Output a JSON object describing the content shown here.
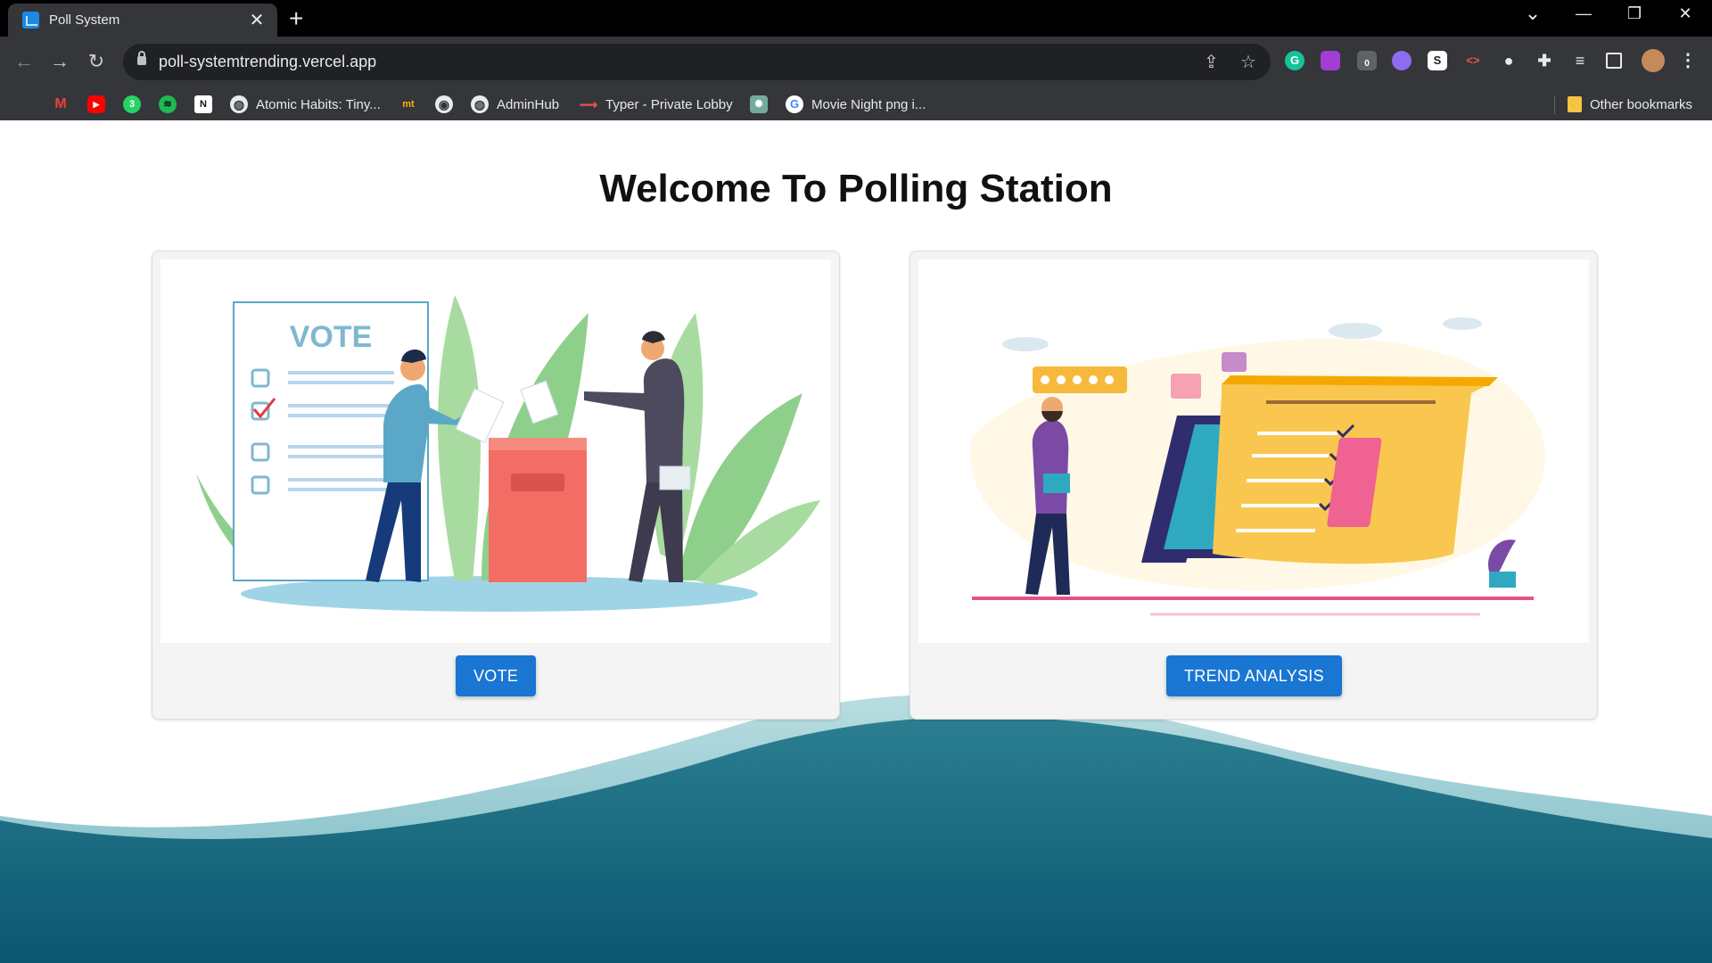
{
  "browser": {
    "tab_title": "Poll System",
    "tab_close": "✕",
    "new_tab": "+",
    "url": "poll-systemtrending.vercel.app",
    "window_controls": {
      "tabsearch": "⌄",
      "minimize": "—",
      "restore": "❐",
      "close": "✕"
    },
    "nav": {
      "back": "←",
      "forward": "→",
      "reload": "↻"
    },
    "omnibox_icons": {
      "share": "⇪",
      "bookmark": "☆"
    },
    "extensions": [
      "G",
      "S",
      "<>",
      "●",
      "0"
    ],
    "bookmarks": [
      {
        "label": "",
        "icon": "profile-icon",
        "color": "#4a6fa5"
      },
      {
        "label": "",
        "icon": "gmail-icon",
        "color": "#ea4335",
        "glyph": "M"
      },
      {
        "label": "",
        "icon": "youtube-icon",
        "color": "#ff0000",
        "glyph": "▶"
      },
      {
        "label": "",
        "icon": "whatsapp-icon",
        "color": "#25d366",
        "glyph": "3"
      },
      {
        "label": "",
        "icon": "spotify-icon",
        "color": "#1db954",
        "glyph": "≋"
      },
      {
        "label": "",
        "icon": "notion-icon",
        "color": "#ffffff",
        "glyph": "N"
      },
      {
        "label": "Atomic Habits: Tiny...",
        "icon": "globe-icon",
        "color": "#e8eaed",
        "glyph": "◍"
      },
      {
        "label": "",
        "icon": "mt-icon",
        "color": "#35363a",
        "glyph": "mt"
      },
      {
        "label": "",
        "icon": "github-icon",
        "color": "#e8eaed",
        "glyph": "◉"
      },
      {
        "label": "AdminHub",
        "icon": "globe-icon",
        "color": "#e8eaed",
        "glyph": "◍"
      },
      {
        "label": "Typer - Private Lobby",
        "icon": "typer-icon",
        "color": "#35363a",
        "glyph": "⟿"
      },
      {
        "label": "",
        "icon": "chatgpt-icon",
        "color": "#74aa9c",
        "glyph": "✺"
      },
      {
        "label": "Movie Night png i...",
        "icon": "google-icon",
        "color": "#ffffff",
        "glyph": "G"
      }
    ],
    "other_bookmarks": "Other bookmarks"
  },
  "page": {
    "heading": "Welcome To Polling Station",
    "cards": {
      "vote": {
        "button": "VOTE",
        "ballot_text": "VOTE"
      },
      "trend": {
        "button": "TREND ANALYSIS"
      }
    }
  },
  "colors": {
    "button": "#1976d2",
    "wave_light": "#a9d3d8",
    "wave_dark": "#0e5a73",
    "ballot_box": "#f26d63",
    "leaf": "#8fcf8c"
  }
}
